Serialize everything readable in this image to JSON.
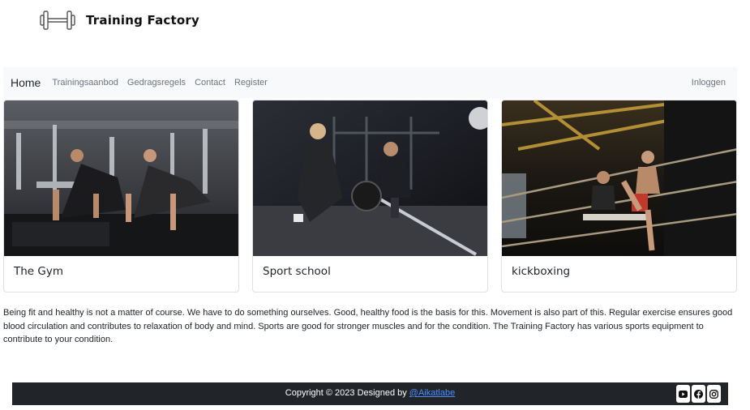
{
  "brand": {
    "name": "Training Factory",
    "logo_icon": "dumbbell-icon"
  },
  "nav": {
    "home": "Home",
    "links": [
      "Trainingsaanbod",
      "Gedragsregels",
      "Contact",
      "Register"
    ],
    "login": "Inloggen"
  },
  "cards": [
    {
      "title": "The Gym",
      "image": "gym-pushup-photo"
    },
    {
      "title": "Sport school",
      "image": "barbell-training-photo"
    },
    {
      "title": "kickboxing",
      "image": "boxing-ring-kick-photo"
    }
  ],
  "intro": "Being fit and healthy is not a matter of course. We have to do something ourselves. Good, healthy food is the basis for this. Movement is also part of this. Regular exercise ensures good blood circulation and contributes to relaxation of body and mind. Sports are good for stronger muscles and for the condition. The Training Factory has various sports equipment to contribute to your condition.",
  "footer": {
    "copyright": "Copyright © 2023 Designed by ",
    "author": "@Aikatlabe",
    "socials": [
      "youtube-icon",
      "facebook-icon",
      "instagram-icon"
    ]
  },
  "colors": {
    "navbar_bg": "#f8f9fa",
    "footer_bg": "#212529",
    "link": "#4d8dff"
  }
}
